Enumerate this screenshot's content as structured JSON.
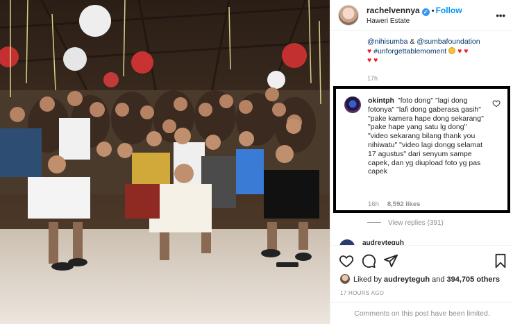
{
  "post": {
    "username": "rachelvennya",
    "follow_label": "Follow",
    "location": "Haweri Estate",
    "more_glyph": "•••",
    "dot": "•"
  },
  "caption": {
    "mention1": "@nihisumba",
    "amp": " & ",
    "mention2": "@sumbafoundation",
    "hashtag": "#unforgettablemoment",
    "time": "17h"
  },
  "comment": {
    "username": "okintph",
    "text": "\"foto dong\" \"lagi dong fotonya\" \"lafi dong gaberasa gasih\" \"pake kamera hape dong sekarang\" \"pake hape yang satu lg dong\" \"video sekarang bilang thank you nihiwatu\" \"video lagi dongg selamat 17 agustus\" dari senyum sampe capek, dan yg diupload foto yg pas capek",
    "time": "16h",
    "likes": "8,592 likes"
  },
  "view_replies": "View replies (391)",
  "next_comment": {
    "username": "audreyteguh"
  },
  "likes": {
    "prefix": "Liked by ",
    "user": "audreyteguh",
    "middle": " and ",
    "count": "394,705 others"
  },
  "time_ago": "17 HOURS AGO",
  "comments_limited": "Comments on this post have been limited.",
  "icons": [
    "verified-icon",
    "more-icon",
    "heart-icon",
    "comment-icon",
    "share-icon",
    "save-icon"
  ],
  "colors": {
    "link": "#00376b",
    "follow": "#0095f6",
    "muted": "#8e8e8e",
    "heart": "#ed1c24"
  }
}
